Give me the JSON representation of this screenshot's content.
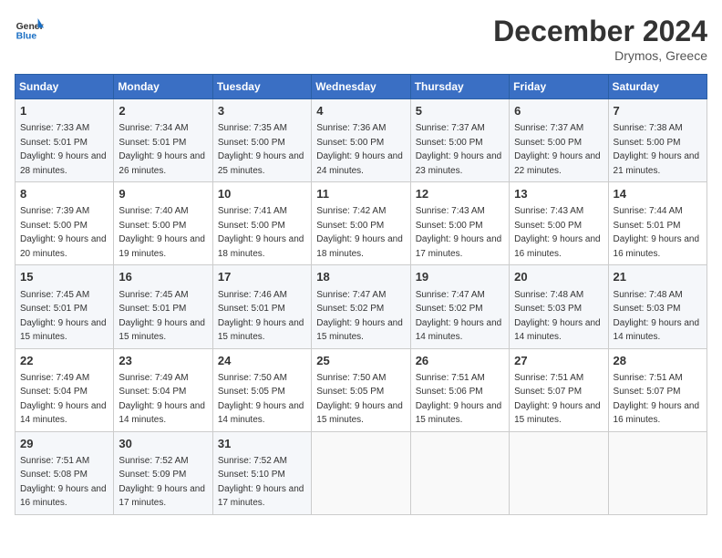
{
  "header": {
    "logo_line1": "General",
    "logo_line2": "Blue",
    "month_title": "December 2024",
    "location": "Drymos, Greece"
  },
  "weekdays": [
    "Sunday",
    "Monday",
    "Tuesday",
    "Wednesday",
    "Thursday",
    "Friday",
    "Saturday"
  ],
  "weeks": [
    [
      {
        "day": "1",
        "sunrise": "7:33 AM",
        "sunset": "5:01 PM",
        "daylight": "9 hours and 28 minutes."
      },
      {
        "day": "2",
        "sunrise": "7:34 AM",
        "sunset": "5:01 PM",
        "daylight": "9 hours and 26 minutes."
      },
      {
        "day": "3",
        "sunrise": "7:35 AM",
        "sunset": "5:00 PM",
        "daylight": "9 hours and 25 minutes."
      },
      {
        "day": "4",
        "sunrise": "7:36 AM",
        "sunset": "5:00 PM",
        "daylight": "9 hours and 24 minutes."
      },
      {
        "day": "5",
        "sunrise": "7:37 AM",
        "sunset": "5:00 PM",
        "daylight": "9 hours and 23 minutes."
      },
      {
        "day": "6",
        "sunrise": "7:37 AM",
        "sunset": "5:00 PM",
        "daylight": "9 hours and 22 minutes."
      },
      {
        "day": "7",
        "sunrise": "7:38 AM",
        "sunset": "5:00 PM",
        "daylight": "9 hours and 21 minutes."
      }
    ],
    [
      {
        "day": "8",
        "sunrise": "7:39 AM",
        "sunset": "5:00 PM",
        "daylight": "9 hours and 20 minutes."
      },
      {
        "day": "9",
        "sunrise": "7:40 AM",
        "sunset": "5:00 PM",
        "daylight": "9 hours and 19 minutes."
      },
      {
        "day": "10",
        "sunrise": "7:41 AM",
        "sunset": "5:00 PM",
        "daylight": "9 hours and 18 minutes."
      },
      {
        "day": "11",
        "sunrise": "7:42 AM",
        "sunset": "5:00 PM",
        "daylight": "9 hours and 18 minutes."
      },
      {
        "day": "12",
        "sunrise": "7:43 AM",
        "sunset": "5:00 PM",
        "daylight": "9 hours and 17 minutes."
      },
      {
        "day": "13",
        "sunrise": "7:43 AM",
        "sunset": "5:00 PM",
        "daylight": "9 hours and 16 minutes."
      },
      {
        "day": "14",
        "sunrise": "7:44 AM",
        "sunset": "5:01 PM",
        "daylight": "9 hours and 16 minutes."
      }
    ],
    [
      {
        "day": "15",
        "sunrise": "7:45 AM",
        "sunset": "5:01 PM",
        "daylight": "9 hours and 15 minutes."
      },
      {
        "day": "16",
        "sunrise": "7:45 AM",
        "sunset": "5:01 PM",
        "daylight": "9 hours and 15 minutes."
      },
      {
        "day": "17",
        "sunrise": "7:46 AM",
        "sunset": "5:01 PM",
        "daylight": "9 hours and 15 minutes."
      },
      {
        "day": "18",
        "sunrise": "7:47 AM",
        "sunset": "5:02 PM",
        "daylight": "9 hours and 15 minutes."
      },
      {
        "day": "19",
        "sunrise": "7:47 AM",
        "sunset": "5:02 PM",
        "daylight": "9 hours and 14 minutes."
      },
      {
        "day": "20",
        "sunrise": "7:48 AM",
        "sunset": "5:03 PM",
        "daylight": "9 hours and 14 minutes."
      },
      {
        "day": "21",
        "sunrise": "7:48 AM",
        "sunset": "5:03 PM",
        "daylight": "9 hours and 14 minutes."
      }
    ],
    [
      {
        "day": "22",
        "sunrise": "7:49 AM",
        "sunset": "5:04 PM",
        "daylight": "9 hours and 14 minutes."
      },
      {
        "day": "23",
        "sunrise": "7:49 AM",
        "sunset": "5:04 PM",
        "daylight": "9 hours and 14 minutes."
      },
      {
        "day": "24",
        "sunrise": "7:50 AM",
        "sunset": "5:05 PM",
        "daylight": "9 hours and 14 minutes."
      },
      {
        "day": "25",
        "sunrise": "7:50 AM",
        "sunset": "5:05 PM",
        "daylight": "9 hours and 15 minutes."
      },
      {
        "day": "26",
        "sunrise": "7:51 AM",
        "sunset": "5:06 PM",
        "daylight": "9 hours and 15 minutes."
      },
      {
        "day": "27",
        "sunrise": "7:51 AM",
        "sunset": "5:07 PM",
        "daylight": "9 hours and 15 minutes."
      },
      {
        "day": "28",
        "sunrise": "7:51 AM",
        "sunset": "5:07 PM",
        "daylight": "9 hours and 16 minutes."
      }
    ],
    [
      {
        "day": "29",
        "sunrise": "7:51 AM",
        "sunset": "5:08 PM",
        "daylight": "9 hours and 16 minutes."
      },
      {
        "day": "30",
        "sunrise": "7:52 AM",
        "sunset": "5:09 PM",
        "daylight": "9 hours and 17 minutes."
      },
      {
        "day": "31",
        "sunrise": "7:52 AM",
        "sunset": "5:10 PM",
        "daylight": "9 hours and 17 minutes."
      },
      null,
      null,
      null,
      null
    ]
  ]
}
